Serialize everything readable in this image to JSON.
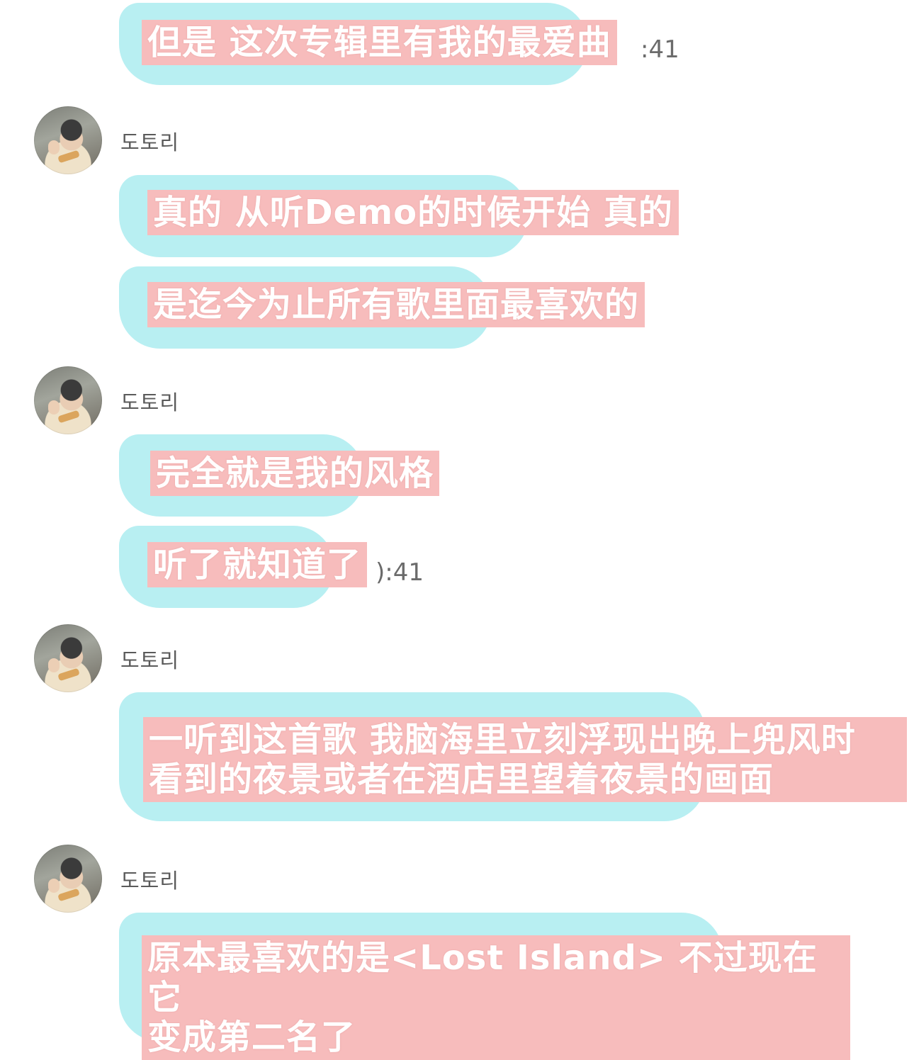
{
  "sender_name": "도토리",
  "messages": [
    {
      "text": "但是 这次专辑里有我的最爱曲",
      "time_fragment": ":41"
    },
    {
      "text": "真的 从听Demo的时候开始 真的"
    },
    {
      "text": "是迄今为止所有歌里面最喜欢的"
    },
    {
      "text": "完全就是我的风格"
    },
    {
      "text": "听了就知道了",
      "time_fragment": "):41"
    },
    {
      "text": "一听到这首歌 我脑海里立刻浮现出晚上兜风时\n看到的夜景或者在酒店里望着夜景的画面"
    },
    {
      "text": "原本最喜欢的是<Lost Island> 不过现在它\n变成第二名了"
    }
  ],
  "colors": {
    "bubble": "#b8eff2",
    "caption_bg": "#f7bcbc",
    "caption_text": "#ffffff",
    "sender_text": "#5a5a5a",
    "time_text": "#6b6b6b",
    "background": "#ffffff"
  },
  "icons": {
    "avatar": "profile-photo-child"
  }
}
